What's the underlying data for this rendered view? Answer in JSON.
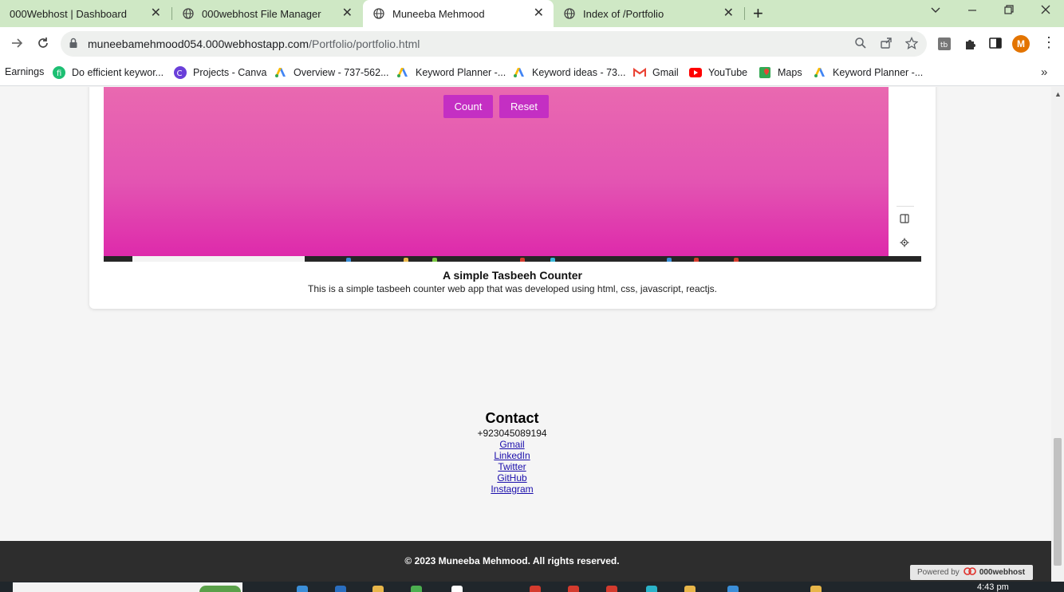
{
  "browser": {
    "tabs": [
      {
        "title": "000Webhost | Dashboard",
        "active": false
      },
      {
        "title": "000webhost File Manager",
        "active": false
      },
      {
        "title": "Muneeba Mehmood",
        "active": true
      },
      {
        "title": "Index of /Portfolio",
        "active": false
      }
    ],
    "url_host": "muneebamehmood054.000webhostapp.com",
    "url_path": "/Portfolio/portfolio.html",
    "avatar_letter": "M",
    "bookmarks": [
      {
        "label": "Earnings",
        "icon": "none"
      },
      {
        "label": "Do efficient keywor...",
        "icon": "fiverr-icon"
      },
      {
        "label": "Projects - Canva",
        "icon": "canva-icon"
      },
      {
        "label": "Overview - 737-562...",
        "icon": "google-ads-icon"
      },
      {
        "label": "Keyword Planner -...",
        "icon": "google-ads-icon"
      },
      {
        "label": "Keyword ideas - 73...",
        "icon": "google-ads-icon"
      },
      {
        "label": "Gmail",
        "icon": "gmail-icon"
      },
      {
        "label": "YouTube",
        "icon": "youtube-icon"
      },
      {
        "label": "Maps",
        "icon": "maps-icon"
      },
      {
        "label": "Keyword Planner -...",
        "icon": "google-ads-icon"
      }
    ]
  },
  "project": {
    "count_label": "Count",
    "reset_label": "Reset",
    "title": "A simple Tasbeeh Counter",
    "description": "This is a simple tasbeeh counter web app that was developed using html, css, javascript, reactjs."
  },
  "contact": {
    "heading": "Contact",
    "phone": "+923045089194",
    "links": [
      "Gmail",
      "LinkedIn",
      "Twitter",
      "GitHub",
      "Instagram"
    ]
  },
  "footer": {
    "copyright": "© 2023 Muneeba Mehmood. All rights reserved.",
    "powered_prefix": "Powered by",
    "powered_brand": "000webhost"
  },
  "taskbar": {
    "clock": "4:43 pm"
  },
  "colors": {
    "tabbar": "#cfe8c5",
    "pink_top": "#ea6cb0",
    "pink_bottom": "#de2aab",
    "counter_button": "#c42fc3",
    "footer": "#2d2d2d",
    "link": "#1a0dab"
  }
}
